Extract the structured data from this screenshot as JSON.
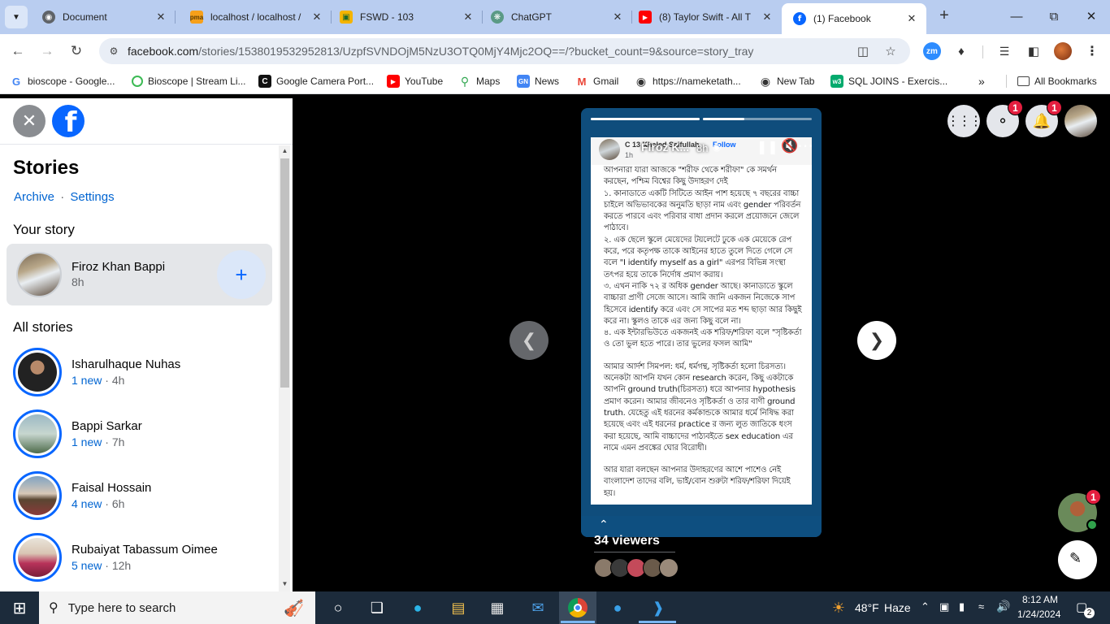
{
  "browser": {
    "tabs": [
      {
        "title": "Document",
        "icon": "globe-icon"
      },
      {
        "title": "localhost / localhost / ",
        "icon": "phpmyadmin-icon"
      },
      {
        "title": "FSWD - 103",
        "icon": "classroom-icon"
      },
      {
        "title": "ChatGPT",
        "icon": "chatgpt-icon"
      },
      {
        "title": "(8) Taylor Swift - All T",
        "icon": "youtube-icon"
      },
      {
        "title": "(1) Facebook",
        "icon": "facebook-icon"
      }
    ],
    "url_host": "facebook.com",
    "url_path": "/stories/1538019532952813/UzpfSVNDOjM5NzU3OTQ0MjY4Mjc2OQ==/?bucket_count=9&source=story_tray",
    "bookmarks": [
      {
        "label": "bioscope - Google...",
        "icon": "google-icon"
      },
      {
        "label": "Bioscope | Stream Li...",
        "icon": "bioscope-icon"
      },
      {
        "label": "Google Camera Port...",
        "icon": "camera-port-icon"
      },
      {
        "label": "YouTube",
        "icon": "youtube-icon"
      },
      {
        "label": "Maps",
        "icon": "maps-icon"
      },
      {
        "label": "News",
        "icon": "news-icon"
      },
      {
        "label": "Gmail",
        "icon": "gmail-icon"
      },
      {
        "label": "https://nameketath...",
        "icon": "globe-icon"
      },
      {
        "label": "New Tab",
        "icon": "globe-icon"
      },
      {
        "label": "SQL JOINS - Exercis...",
        "icon": "w3schools-icon"
      }
    ],
    "all_bookmarks": "All Bookmarks"
  },
  "panel": {
    "title": "Stories",
    "archive": "Archive",
    "separator": "·",
    "settings": "Settings",
    "your_story_heading": "Your story",
    "my_story": {
      "name": "Firoz Khan Bappi",
      "time": "8h"
    },
    "all_stories_heading": "All stories",
    "stories": [
      {
        "name": "Isharulhaque Nuhas",
        "new": "1 new",
        "time": "4h"
      },
      {
        "name": "Bappi Sarkar",
        "new": "1 new",
        "time": "7h"
      },
      {
        "name": "Faisal Hossain",
        "new": "4 new",
        "time": "6h"
      },
      {
        "name": "Rubaiyat Tabassum Oimee",
        "new": "5 new",
        "time": "12h"
      }
    ],
    "meta_sep": "·"
  },
  "viewer": {
    "messenger_badge": "1",
    "notifications_badge": "1",
    "story_author": "Firoz K...",
    "story_time": "8h",
    "post_author": "C 13 Khaled Saifullah",
    "post_follow": "Follow",
    "post_time": "1h",
    "post_paragraphs": [
      "আপনারা যারা আজকে \"শরীফ থেকে শরীফা\" কে সমর্থন করছেন, পশ্চিম বিশ্বের কিছু উদাহরণ দেই",
      "১. কানাডাতে একটি সিটিতে আইন পাশ হয়েছে ৭ বছরের বাচ্চা চাইলে অভিভাবকের অনুমতি ছাড়া নাম এবং gender পরিবর্তন করতে পারবে এবং পরিবার বাধা প্রদান করলে প্রয়োজনে জেলে পাঠাবে।",
      "২. এক ছেলে স্কুলে মেয়েদের টয়লেটে ঢুকে এক মেয়েকে রেপ করে, পরে কতৃপক্ষ তাকে আইনের হাতে তুলে দিতে গেলে সে বলে \"I identify myself as a girl\" এরপর বিভিন্ন সংস্থা তৎপর হয়ে তাকে নির্দোষ প্রমাণ করায়।",
      "৩. এখন নাকি ৭২ র অধিক gender আছে। কানাডাতে স্কুলে বাচ্চারা প্রাণী সেজে আসে। আমি জানি একজন নিজেকে সাপ হিসেবে identify করে এবং সে সাপের মত শব্দ ছাড়া আর কিছুই করে না। স্কুলও তাকে এর জন্য কিছু বলে না।",
      "৪. এক ইন্টারভিউতে একজনই এক শরিফ/শরিফা বলে \"সৃষ্টিকর্তা ও তো ভুল হতে পারে। তার ভুলের ফসল আমি\"",
      "আমার আর্দশ সিমপল: ধর্ম, ধর্মগন্থ, সৃষ্টিকর্তা হলো চিরসত্য। অনেকটা আপনি যখন কোন research করেন, কিছু একটাকে আপনি ground truth(চিরসত্য) ধরে আপনার hypothesis প্রমাণ করেন। আমার জীবনেও সৃষ্টিকর্তা ও তার বাণী ground truth. যেহেতু এই ধরনের কর্মকান্ডকে আমার ধর্মে নিষিদ্ধ করা হয়েছে এবং এই ধরনের practice র জন্য লুত জাতিকে ধংস করা হয়েছে, আমি বাচ্চাদের পাঠ্যবইতে sex education এর নামে এমন প্রবঙ্কের ঘোর বিরোধী।",
      "আর যারা বলছেন আপনার উদাহরণের আশে পাশেও নেই বাংলাদেশ তাদের বলি, ভাই/বোন শুরুটা শরিফ/শরিফা দিয়েই হয়।"
    ],
    "viewers": "34 viewers",
    "chat_badge": "1"
  },
  "taskbar": {
    "search_placeholder": "Type here to search",
    "weather_temp": "48°F",
    "weather_desc": "Haze",
    "time": "8:12 AM",
    "date": "1/24/2024",
    "notif_count": "2"
  }
}
